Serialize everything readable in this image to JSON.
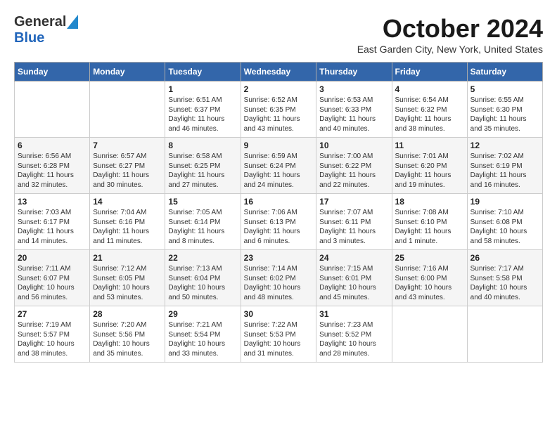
{
  "header": {
    "logo_general": "General",
    "logo_blue": "Blue",
    "month": "October 2024",
    "location": "East Garden City, New York, United States"
  },
  "weekdays": [
    "Sunday",
    "Monday",
    "Tuesday",
    "Wednesday",
    "Thursday",
    "Friday",
    "Saturday"
  ],
  "weeks": [
    [
      {
        "day": "",
        "info": ""
      },
      {
        "day": "",
        "info": ""
      },
      {
        "day": "1",
        "info": "Sunrise: 6:51 AM\nSunset: 6:37 PM\nDaylight: 11 hours and 46 minutes."
      },
      {
        "day": "2",
        "info": "Sunrise: 6:52 AM\nSunset: 6:35 PM\nDaylight: 11 hours and 43 minutes."
      },
      {
        "day": "3",
        "info": "Sunrise: 6:53 AM\nSunset: 6:33 PM\nDaylight: 11 hours and 40 minutes."
      },
      {
        "day": "4",
        "info": "Sunrise: 6:54 AM\nSunset: 6:32 PM\nDaylight: 11 hours and 38 minutes."
      },
      {
        "day": "5",
        "info": "Sunrise: 6:55 AM\nSunset: 6:30 PM\nDaylight: 11 hours and 35 minutes."
      }
    ],
    [
      {
        "day": "6",
        "info": "Sunrise: 6:56 AM\nSunset: 6:28 PM\nDaylight: 11 hours and 32 minutes."
      },
      {
        "day": "7",
        "info": "Sunrise: 6:57 AM\nSunset: 6:27 PM\nDaylight: 11 hours and 30 minutes."
      },
      {
        "day": "8",
        "info": "Sunrise: 6:58 AM\nSunset: 6:25 PM\nDaylight: 11 hours and 27 minutes."
      },
      {
        "day": "9",
        "info": "Sunrise: 6:59 AM\nSunset: 6:24 PM\nDaylight: 11 hours and 24 minutes."
      },
      {
        "day": "10",
        "info": "Sunrise: 7:00 AM\nSunset: 6:22 PM\nDaylight: 11 hours and 22 minutes."
      },
      {
        "day": "11",
        "info": "Sunrise: 7:01 AM\nSunset: 6:20 PM\nDaylight: 11 hours and 19 minutes."
      },
      {
        "day": "12",
        "info": "Sunrise: 7:02 AM\nSunset: 6:19 PM\nDaylight: 11 hours and 16 minutes."
      }
    ],
    [
      {
        "day": "13",
        "info": "Sunrise: 7:03 AM\nSunset: 6:17 PM\nDaylight: 11 hours and 14 minutes."
      },
      {
        "day": "14",
        "info": "Sunrise: 7:04 AM\nSunset: 6:16 PM\nDaylight: 11 hours and 11 minutes."
      },
      {
        "day": "15",
        "info": "Sunrise: 7:05 AM\nSunset: 6:14 PM\nDaylight: 11 hours and 8 minutes."
      },
      {
        "day": "16",
        "info": "Sunrise: 7:06 AM\nSunset: 6:13 PM\nDaylight: 11 hours and 6 minutes."
      },
      {
        "day": "17",
        "info": "Sunrise: 7:07 AM\nSunset: 6:11 PM\nDaylight: 11 hours and 3 minutes."
      },
      {
        "day": "18",
        "info": "Sunrise: 7:08 AM\nSunset: 6:10 PM\nDaylight: 11 hours and 1 minute."
      },
      {
        "day": "19",
        "info": "Sunrise: 7:10 AM\nSunset: 6:08 PM\nDaylight: 10 hours and 58 minutes."
      }
    ],
    [
      {
        "day": "20",
        "info": "Sunrise: 7:11 AM\nSunset: 6:07 PM\nDaylight: 10 hours and 56 minutes."
      },
      {
        "day": "21",
        "info": "Sunrise: 7:12 AM\nSunset: 6:05 PM\nDaylight: 10 hours and 53 minutes."
      },
      {
        "day": "22",
        "info": "Sunrise: 7:13 AM\nSunset: 6:04 PM\nDaylight: 10 hours and 50 minutes."
      },
      {
        "day": "23",
        "info": "Sunrise: 7:14 AM\nSunset: 6:02 PM\nDaylight: 10 hours and 48 minutes."
      },
      {
        "day": "24",
        "info": "Sunrise: 7:15 AM\nSunset: 6:01 PM\nDaylight: 10 hours and 45 minutes."
      },
      {
        "day": "25",
        "info": "Sunrise: 7:16 AM\nSunset: 6:00 PM\nDaylight: 10 hours and 43 minutes."
      },
      {
        "day": "26",
        "info": "Sunrise: 7:17 AM\nSunset: 5:58 PM\nDaylight: 10 hours and 40 minutes."
      }
    ],
    [
      {
        "day": "27",
        "info": "Sunrise: 7:19 AM\nSunset: 5:57 PM\nDaylight: 10 hours and 38 minutes."
      },
      {
        "day": "28",
        "info": "Sunrise: 7:20 AM\nSunset: 5:56 PM\nDaylight: 10 hours and 35 minutes."
      },
      {
        "day": "29",
        "info": "Sunrise: 7:21 AM\nSunset: 5:54 PM\nDaylight: 10 hours and 33 minutes."
      },
      {
        "day": "30",
        "info": "Sunrise: 7:22 AM\nSunset: 5:53 PM\nDaylight: 10 hours and 31 minutes."
      },
      {
        "day": "31",
        "info": "Sunrise: 7:23 AM\nSunset: 5:52 PM\nDaylight: 10 hours and 28 minutes."
      },
      {
        "day": "",
        "info": ""
      },
      {
        "day": "",
        "info": ""
      }
    ]
  ]
}
